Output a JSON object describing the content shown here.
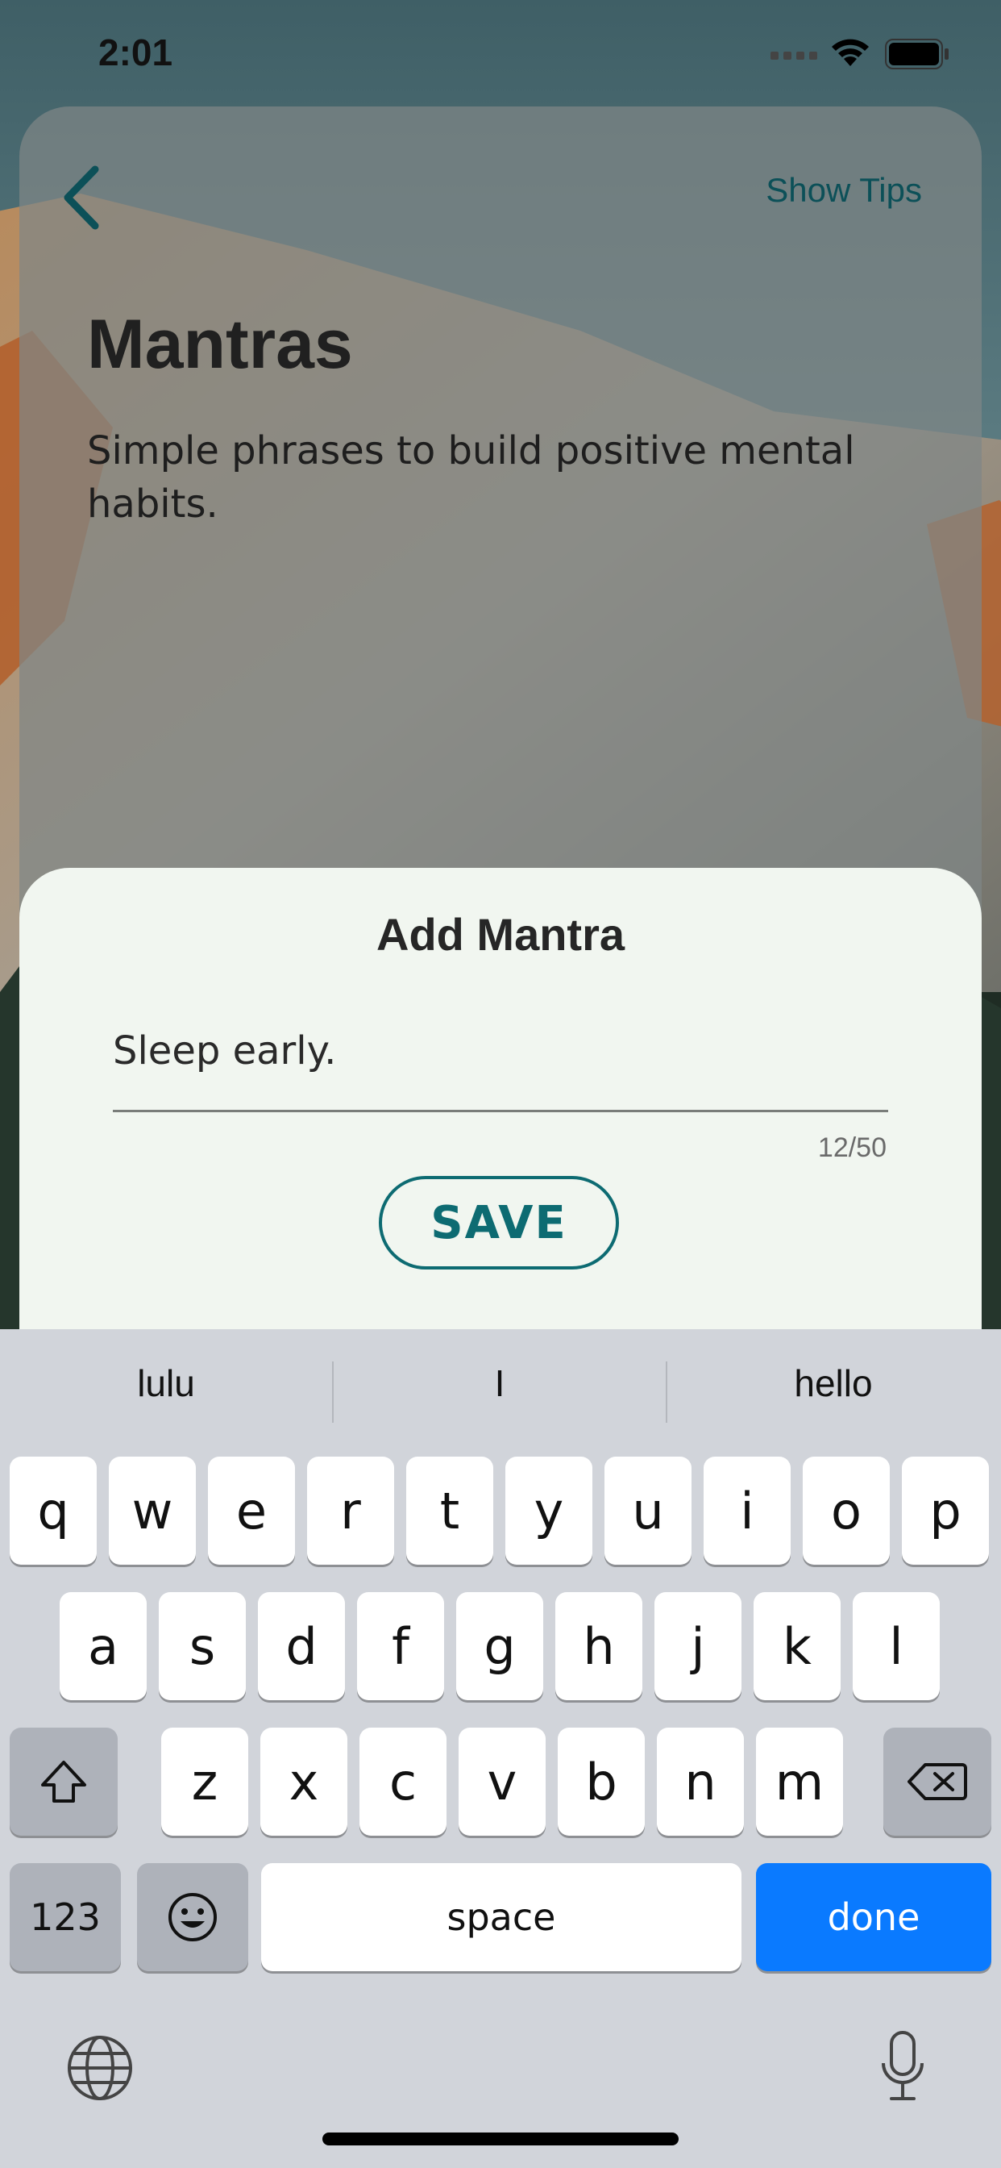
{
  "status_bar": {
    "time": "2:01"
  },
  "header": {
    "show_tips_label": "Show Tips"
  },
  "page": {
    "title": "Mantras",
    "subtitle": "Simple phrases to build positive mental habits."
  },
  "sheet": {
    "title": "Add Mantra",
    "input_value": "Sleep early.",
    "char_counter": "12/50",
    "save_label": "SAVE"
  },
  "keyboard": {
    "suggestions": [
      "lulu",
      "I",
      "hello"
    ],
    "row1": [
      "q",
      "w",
      "e",
      "r",
      "t",
      "y",
      "u",
      "i",
      "o",
      "p"
    ],
    "row2": [
      "a",
      "s",
      "d",
      "f",
      "g",
      "h",
      "j",
      "k",
      "l"
    ],
    "row3": [
      "z",
      "x",
      "c",
      "v",
      "b",
      "n",
      "m"
    ],
    "numbers_label": "123",
    "space_label": "space",
    "done_label": "done"
  },
  "colors": {
    "accent": "#0d6b72",
    "keyboard_bg": "#d1d4da",
    "done_blue": "#0a7aff",
    "sheet_bg": "#f1f6f0"
  },
  "icons": [
    "chevron-left-icon",
    "signal-icon",
    "wifi-icon",
    "battery-icon",
    "shift-icon",
    "backspace-icon",
    "emoji-icon",
    "globe-icon",
    "microphone-icon"
  ]
}
